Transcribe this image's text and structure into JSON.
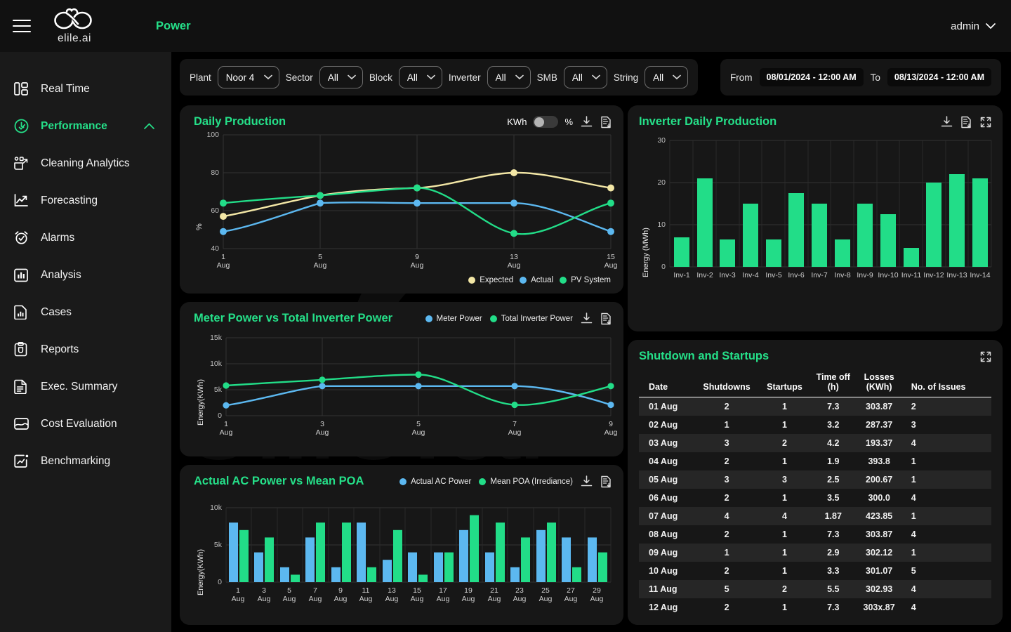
{
  "brand": {
    "name": "elile.ai",
    "app_title": "Power",
    "logo_icon": "infinity-cloud-logo"
  },
  "header": {
    "menu_icon": "hamburger-icon",
    "user": "admin",
    "user_chevron_icon": "chevron-down-icon"
  },
  "sidebar": {
    "items": [
      {
        "label": "Real Time",
        "icon": "dashboard-icon",
        "active": false
      },
      {
        "label": "Performance",
        "icon": "clock-check-icon",
        "active": true,
        "chevron": "chevron-up-icon"
      },
      {
        "label": "Cleaning Analytics",
        "icon": "cleaning-icon",
        "active": false
      },
      {
        "label": "Forecasting",
        "icon": "trend-up-icon",
        "active": false
      },
      {
        "label": "Alarms",
        "icon": "alarm-clock-icon",
        "active": false
      },
      {
        "label": "Analysis",
        "icon": "bar-chart-icon",
        "active": false
      },
      {
        "label": "Cases",
        "icon": "file-chart-icon",
        "active": false
      },
      {
        "label": "Reports",
        "icon": "clipboard-icon",
        "active": false
      },
      {
        "label": "Exec. Summary",
        "icon": "document-icon",
        "active": false
      },
      {
        "label": "Cost Evaluation",
        "icon": "card-icon",
        "active": false
      },
      {
        "label": "Benchmarking",
        "icon": "benchmark-icon",
        "active": false
      }
    ]
  },
  "filters": {
    "plant": {
      "label": "Plant",
      "value": "Noor 4"
    },
    "sector": {
      "label": "Sector",
      "value": "All"
    },
    "block": {
      "label": "Block",
      "value": "All"
    },
    "inverter": {
      "label": "Inverter",
      "value": "All"
    },
    "smb": {
      "label": "SMB",
      "value": "All"
    },
    "string": {
      "label": "String",
      "value": "All"
    },
    "from": {
      "label": "From",
      "value": "08/01/2024 - 12:00 AM"
    },
    "to": {
      "label": "To",
      "value": "08/13/2024 - 12:00 AM"
    },
    "chevron_icon": "chevron-down-icon"
  },
  "panels": {
    "daily_production": {
      "title": "Daily Production",
      "unit_left": "KWh",
      "unit_right": "%",
      "toggle_state": "off",
      "tools": [
        "download-icon",
        "export-report-icon"
      ]
    },
    "inverter_daily": {
      "title": "Inverter Daily Production",
      "tools": [
        "download-icon",
        "export-report-icon",
        "expand-icon"
      ]
    },
    "meter_vs_inverter": {
      "title": "Meter Power vs Total Inverter Power",
      "tools": [
        "download-icon",
        "export-report-icon"
      ]
    },
    "ac_vs_poa": {
      "title": "Actual AC Power vs Mean POA",
      "tools": [
        "download-icon",
        "export-report-icon"
      ]
    },
    "shutdowns": {
      "title": "Shutdown and Startups",
      "tools": [
        "expand-icon"
      ]
    }
  },
  "colors": {
    "accent_green": "#25E089",
    "series_expected": "#F3E7A6",
    "series_actual": "#5CB8F0",
    "series_pv": "#22DD88",
    "panel_bg": "#171717",
    "sidebar_bg": "#1a1a1a",
    "page_bg": "#000000"
  },
  "chart_data": [
    {
      "id": "daily_production",
      "type": "line",
      "title": "Daily Production",
      "xlabel": "",
      "ylabel": "%",
      "x": [
        "1 Aug",
        "5 Aug",
        "9 Aug",
        "13 Aug",
        "15 Aug"
      ],
      "xtick_labels": [
        "1\nAug",
        "5\nAug",
        "9\nAug",
        "13\nAug",
        "15\nAug"
      ],
      "ylim": [
        40,
        100
      ],
      "yticks": [
        40,
        60,
        80,
        100
      ],
      "grid": true,
      "legend_position": "bottom-right",
      "series": [
        {
          "name": "Expected",
          "color": "#F3E7A6",
          "values": [
            57,
            68,
            72,
            80,
            72
          ]
        },
        {
          "name": "Actual",
          "color": "#5CB8F0",
          "values": [
            49,
            64,
            64,
            64,
            49
          ]
        },
        {
          "name": "PV System",
          "color": "#22DD88",
          "values": [
            64,
            68,
            72,
            48,
            64
          ]
        }
      ]
    },
    {
      "id": "inverter_daily",
      "type": "bar",
      "title": "Inverter Daily Production",
      "xlabel": "",
      "ylabel": "Energy (MWh)",
      "categories": [
        "Inv-1",
        "Inv-2",
        "Inv-3",
        "Inv-4",
        "Inv-5",
        "Inv-6",
        "Inv-7",
        "Inv-8",
        "Inv-9",
        "Inv-10",
        "Inv-11",
        "Inv-12",
        "Inv-13",
        "Inv-14"
      ],
      "values": [
        7,
        21,
        6.5,
        15,
        6.5,
        17.5,
        15,
        6.5,
        15,
        12.5,
        4.5,
        20,
        22,
        21
      ],
      "ylim": [
        0,
        30
      ],
      "yticks": [
        0,
        10,
        20,
        30
      ],
      "grid": true,
      "bar_color": "#22DD88"
    },
    {
      "id": "meter_vs_inverter",
      "type": "line",
      "title": "Meter Power vs Total Inverter Power",
      "xlabel": "",
      "ylabel": "Energy(KWh)",
      "x": [
        "1 Aug",
        "3 Aug",
        "5 Aug",
        "7 Aug",
        "9 Aug"
      ],
      "ylim": [
        0,
        15000
      ],
      "yticks": [
        0,
        5000,
        10000,
        15000
      ],
      "ytick_labels": [
        "0",
        "5k",
        "10k",
        "15k"
      ],
      "grid": true,
      "legend_position": "top-right",
      "series": [
        {
          "name": "Meter Power",
          "color": "#5CB8F0",
          "values": [
            2000,
            5700,
            5700,
            5700,
            2100
          ]
        },
        {
          "name": "Total Inverter Power",
          "color": "#22DD88",
          "values": [
            5800,
            6900,
            7900,
            2100,
            5700
          ]
        }
      ]
    },
    {
      "id": "ac_vs_poa",
      "type": "bar",
      "title": "Actual AC Power vs Mean POA",
      "xlabel": "",
      "ylabel": "Energy(KWh)",
      "categories": [
        "1 Aug",
        "3 Aug",
        "5 Aug",
        "7 Aug",
        "9 Aug",
        "11 Aug",
        "13 Aug",
        "15 Aug",
        "17 Aug",
        "19 Aug",
        "21 Aug",
        "23 Aug",
        "25 Aug",
        "27 Aug",
        "29 Aug"
      ],
      "ylim": [
        0,
        10000
      ],
      "yticks": [
        0,
        5000,
        10000
      ],
      "ytick_labels": [
        "0",
        "5k",
        "10k"
      ],
      "grid": true,
      "legend_position": "top-right",
      "series": [
        {
          "name": "Actual AC Power",
          "color": "#5CB8F0",
          "values": [
            8000,
            4000,
            2000,
            6000,
            2000,
            8000,
            3000,
            4000,
            4000,
            7000,
            4000,
            2000,
            7000,
            6000,
            6000
          ]
        },
        {
          "name": "Mean POA (Irrediance)",
          "color": "#22DD88",
          "values": [
            7000,
            6000,
            1000,
            8000,
            8000,
            2000,
            7000,
            1000,
            4000,
            9000,
            8000,
            6000,
            8000,
            2000,
            4000
          ]
        }
      ]
    }
  ],
  "shutdown_table": {
    "columns": [
      "Date",
      "Shutdowns",
      "Startups",
      "Time off\n(h)",
      "Losses\n(KWh)",
      "No. of Issues"
    ],
    "columns_display": [
      {
        "l1": "",
        "l2": "Date"
      },
      {
        "l1": "",
        "l2": "Shutdowns"
      },
      {
        "l1": "",
        "l2": "Startups"
      },
      {
        "l1": "Time off",
        "l2": "(h)"
      },
      {
        "l1": "Losses",
        "l2": "(KWh)"
      },
      {
        "l1": "",
        "l2": "No. of Issues"
      }
    ],
    "rows": [
      {
        "date": "01 Aug",
        "shutdowns": "2",
        "startups": "1",
        "time_off": "7.3",
        "losses": "303.87",
        "issues": "2"
      },
      {
        "date": "02 Aug",
        "shutdowns": "1",
        "startups": "1",
        "time_off": "3.2",
        "losses": "287.37",
        "issues": "3"
      },
      {
        "date": "03 Aug",
        "shutdowns": "3",
        "startups": "2",
        "time_off": "4.2",
        "losses": "193.37",
        "issues": "4"
      },
      {
        "date": "04 Aug",
        "shutdowns": "2",
        "startups": "1",
        "time_off": "1.9",
        "losses": "393.8",
        "issues": "1"
      },
      {
        "date": "05 Aug",
        "shutdowns": "3",
        "startups": "3",
        "time_off": "2.5",
        "losses": "200.67",
        "issues": "1"
      },
      {
        "date": "06 Aug",
        "shutdowns": "2",
        "startups": "1",
        "time_off": "3.5",
        "losses": "300.0",
        "issues": "4"
      },
      {
        "date": "07 Aug",
        "shutdowns": "4",
        "startups": "4",
        "time_off": "1.87",
        "losses": "423.85",
        "issues": "1"
      },
      {
        "date": "08 Aug",
        "shutdowns": "2",
        "startups": "1",
        "time_off": "7.3",
        "losses": "303.87",
        "issues": "4"
      },
      {
        "date": "09 Aug",
        "shutdowns": "1",
        "startups": "1",
        "time_off": "2.9",
        "losses": "302.12",
        "issues": "1"
      },
      {
        "date": "10 Aug",
        "shutdowns": "2",
        "startups": "1",
        "time_off": "3.3",
        "losses": "301.07",
        "issues": "5"
      },
      {
        "date": "11 Aug",
        "shutdowns": "5",
        "startups": "2",
        "time_off": "5.5",
        "losses": "302.93",
        "issues": "4"
      },
      {
        "date": "12 Aug",
        "shutdowns": "2",
        "startups": "1",
        "time_off": "7.3",
        "losses": "303x.87",
        "issues": "4"
      }
    ]
  },
  "watermark": {
    "glyph": "ع",
    "text": "elile.ai"
  }
}
